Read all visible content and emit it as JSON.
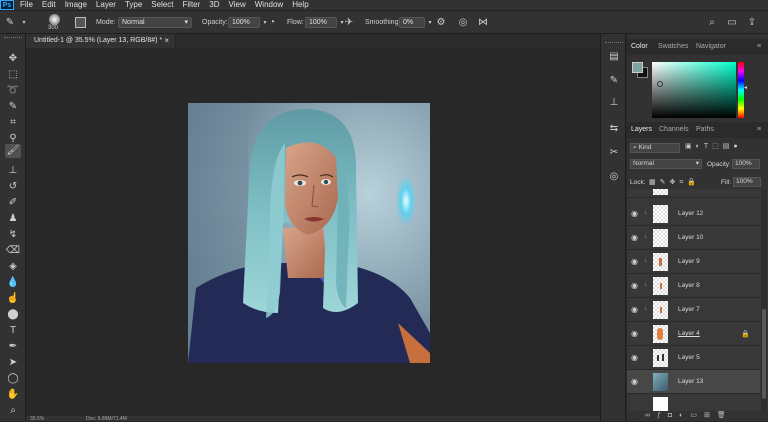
{
  "app": {
    "logo": "Ps",
    "menu": [
      "File",
      "Edit",
      "Image",
      "Layer",
      "Type",
      "Select",
      "Filter",
      "3D",
      "View",
      "Window",
      "Help"
    ]
  },
  "options": {
    "brush_size": "300",
    "mode_label": "Mode:",
    "mode_value": "Normal",
    "opacity_label": "Opacity:",
    "opacity_value": "100%",
    "flow_label": "Flow:",
    "flow_value": "100%",
    "smoothing_label": "Smoothing:",
    "smoothing_value": "0%"
  },
  "document": {
    "tab_title": "Untitled-1 @ 35.5% (Layer 13, RGB/8#) *",
    "close_glyph": "×"
  },
  "statusbar": {
    "zoom": "35.5%",
    "doc_info": "Doc: 9.89M/71.4M"
  },
  "color_panel": {
    "tabs": [
      "Color",
      "Swatches",
      "Navigator"
    ],
    "foreground": "#7fa3a3",
    "background": "#111111",
    "hue_base": "#00ffcc"
  },
  "layers_panel": {
    "tabs": [
      "Layers",
      "Channels",
      "Paths"
    ],
    "filter_value": "Kind",
    "blend_value": "Normal",
    "opacity_label": "Opacity:",
    "opacity_value": "100%",
    "lock_label": "Lock:",
    "fill_label": "Fill:",
    "fill_value": "100%",
    "layers": [
      {
        "name": "Layer 12",
        "visible": true,
        "clipped": true
      },
      {
        "name": "Layer 10",
        "visible": true,
        "clipped": true
      },
      {
        "name": "Layer 9",
        "visible": true,
        "clipped": true
      },
      {
        "name": "Layer 8",
        "visible": true,
        "clipped": true
      },
      {
        "name": "Layer 7",
        "visible": true,
        "clipped": true
      },
      {
        "name": "Layer 4",
        "visible": true,
        "clipped": false,
        "locked": true
      },
      {
        "name": "Layer 5",
        "visible": true,
        "clipped": false
      },
      {
        "name": "Layer 13",
        "visible": true,
        "clipped": false,
        "selected": true
      }
    ]
  }
}
